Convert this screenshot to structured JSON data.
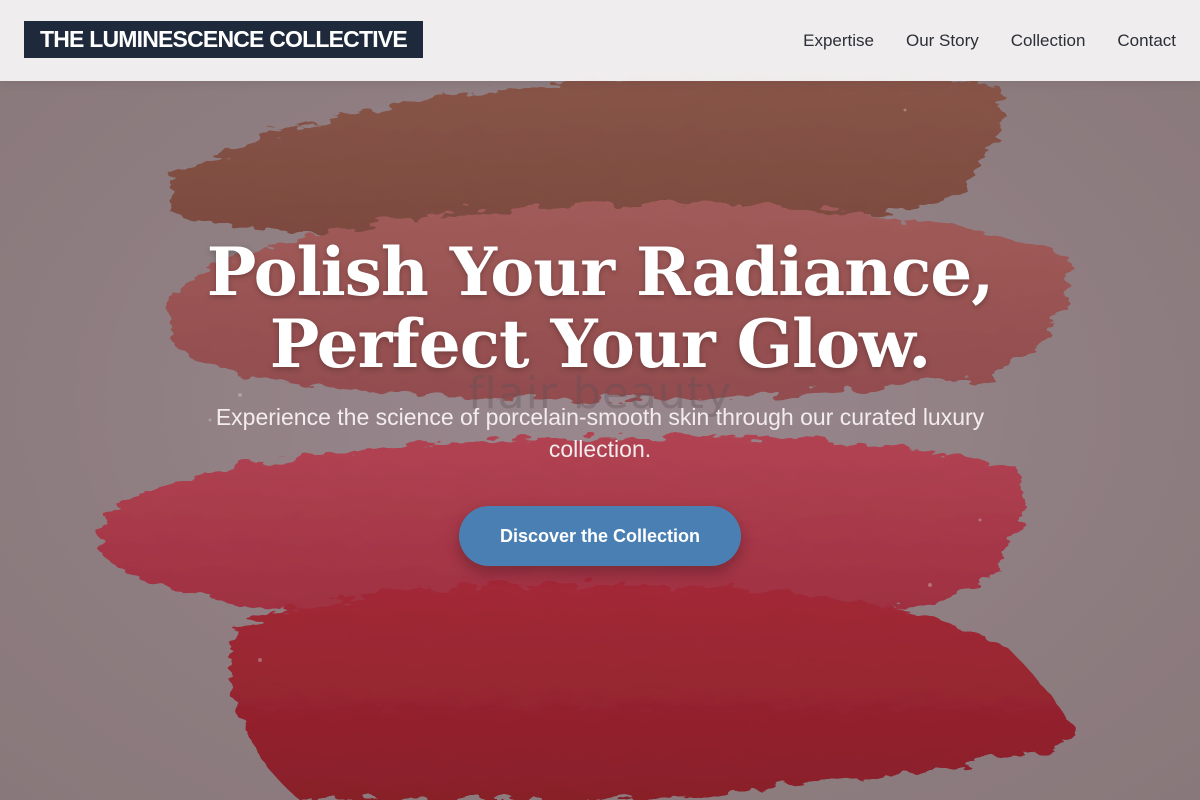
{
  "header": {
    "logo_text": "THE LUMINESCENCE COLLECTIVE",
    "nav": [
      {
        "label": "Expertise"
      },
      {
        "label": "Our Story"
      },
      {
        "label": "Collection"
      },
      {
        "label": "Contact"
      }
    ]
  },
  "hero": {
    "headline_line1": "Polish Your Radiance,",
    "headline_line2": "Perfect Your Glow.",
    "watermark": "flair beauty",
    "subtext": "Experience the science of porcelain-smooth skin through our curated luxury collection.",
    "cta_label": "Discover the Collection"
  },
  "colors": {
    "logo_bg": "#1e2a3c",
    "cta_bg": "#4a7fb3",
    "stroke_brown": "#8a4a3a",
    "stroke_rose": "#a8514f",
    "stroke_crimson": "#b4283f",
    "stroke_red": "#a2101f"
  }
}
